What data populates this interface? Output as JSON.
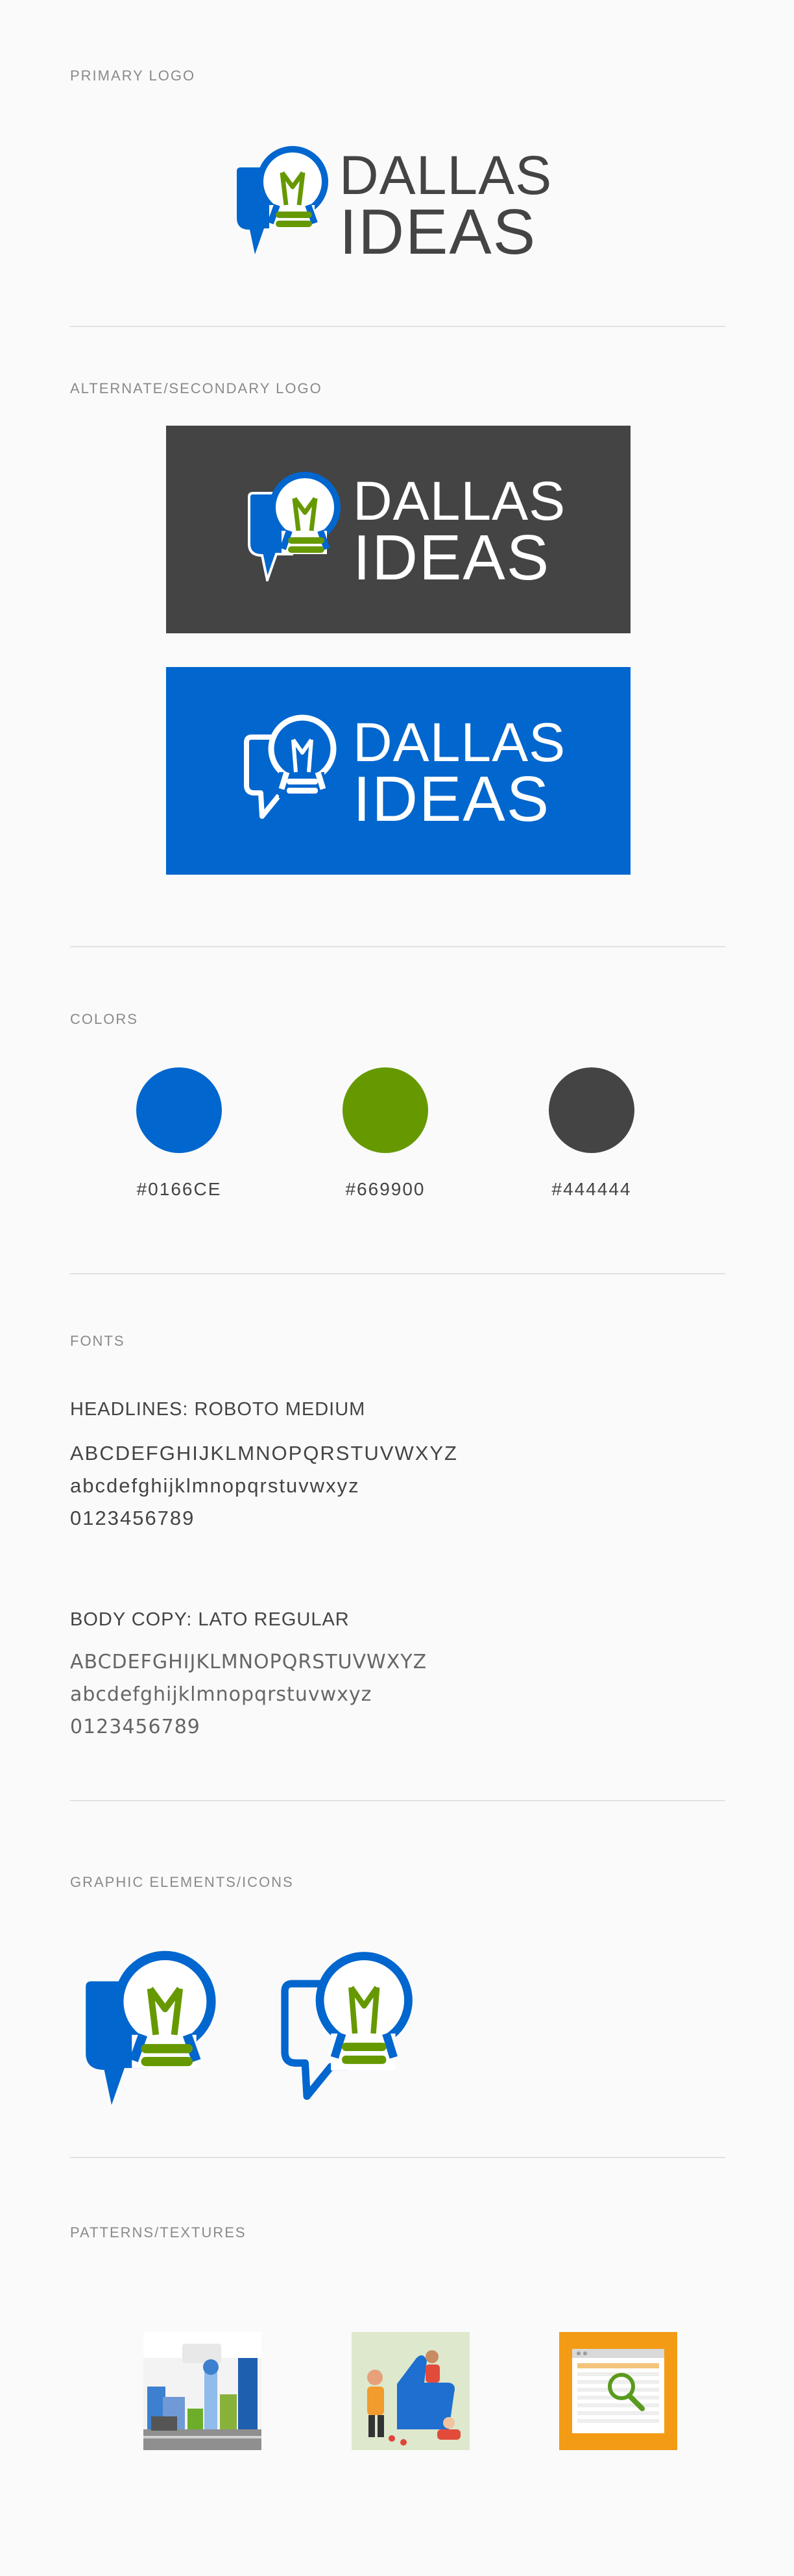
{
  "sections": {
    "primary_logo": "PRIMARY LOGO",
    "alternate_logo": "ALTERNATE/SECONDARY LOGO",
    "colors": "COLORS",
    "fonts": "FONTS",
    "graphic_elements": "GRAPHIC ELEMENTS/ICONS",
    "patterns": "PATTERNS/TEXTURES"
  },
  "logo": {
    "line1": "DALLAS",
    "line2": "IDEAS"
  },
  "colors": [
    {
      "hex": "#0166CE",
      "code": "#0166CE"
    },
    {
      "hex": "#669900",
      "code": "#669900"
    },
    {
      "hex": "#444444",
      "code": "#444444"
    }
  ],
  "fonts": {
    "headlines": {
      "title": "HEADLINES: ROBOTO MEDIUM",
      "upper": "ABCDEFGHIJKLMNOPQRSTUVWXYZ",
      "lower": "abcdefghijklmnopqrstuvwxyz",
      "digits": "0123456789"
    },
    "body": {
      "title": "BODY COPY: LATO REGULAR",
      "upper": "ABCDEFGHIJKLMNOPQRSTUVWXYZ",
      "lower": "abcdefghijklmnopqrstuvwxyz",
      "digits": "0123456789"
    }
  }
}
